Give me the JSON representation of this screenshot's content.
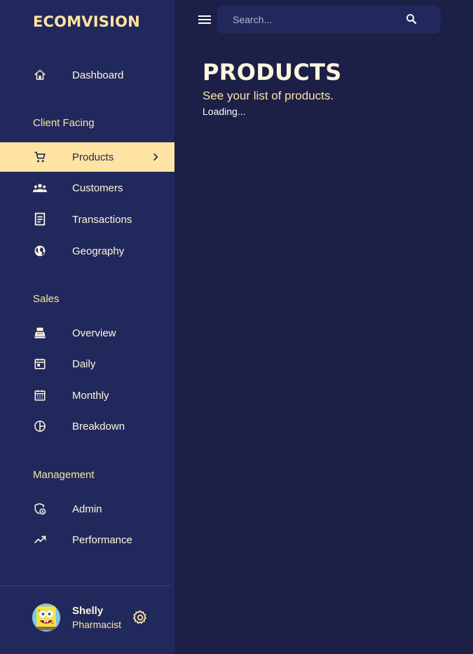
{
  "brand": "ECOMVISION",
  "sidebar": {
    "dashboard": "Dashboard",
    "sections": {
      "client": "Client Facing",
      "sales": "Sales",
      "management": "Management"
    },
    "items": {
      "products": "Products",
      "customers": "Customers",
      "transactions": "Transactions",
      "geography": "Geography",
      "overview": "Overview",
      "daily": "Daily",
      "monthly": "Monthly",
      "breakdown": "Breakdown",
      "admin": "Admin",
      "performance": "Performance"
    },
    "active_item": "Products"
  },
  "user": {
    "name": "Shelly",
    "role": "Pharmacist"
  },
  "search": {
    "placeholder": "Search...",
    "value": ""
  },
  "header": {
    "title": "PRODUCTS",
    "subtitle": "See your list of products.",
    "status": "Loading..."
  },
  "colors": {
    "background": "#1c1f46",
    "sidebar": "#21295c",
    "accent": "#ffe3a3",
    "text": "#fff6e0"
  },
  "icons": {
    "dashboard": "home-icon",
    "products": "cart-icon",
    "customers": "groups-icon",
    "transactions": "receipt-icon",
    "geography": "globe-icon",
    "overview": "point-of-sale-icon",
    "daily": "calendar-today-icon",
    "monthly": "calendar-month-icon",
    "breakdown": "pie-chart-icon",
    "admin": "admin-shield-icon",
    "performance": "trending-up-icon",
    "menu": "menu-icon",
    "search": "search-icon",
    "settings": "gear-icon"
  }
}
